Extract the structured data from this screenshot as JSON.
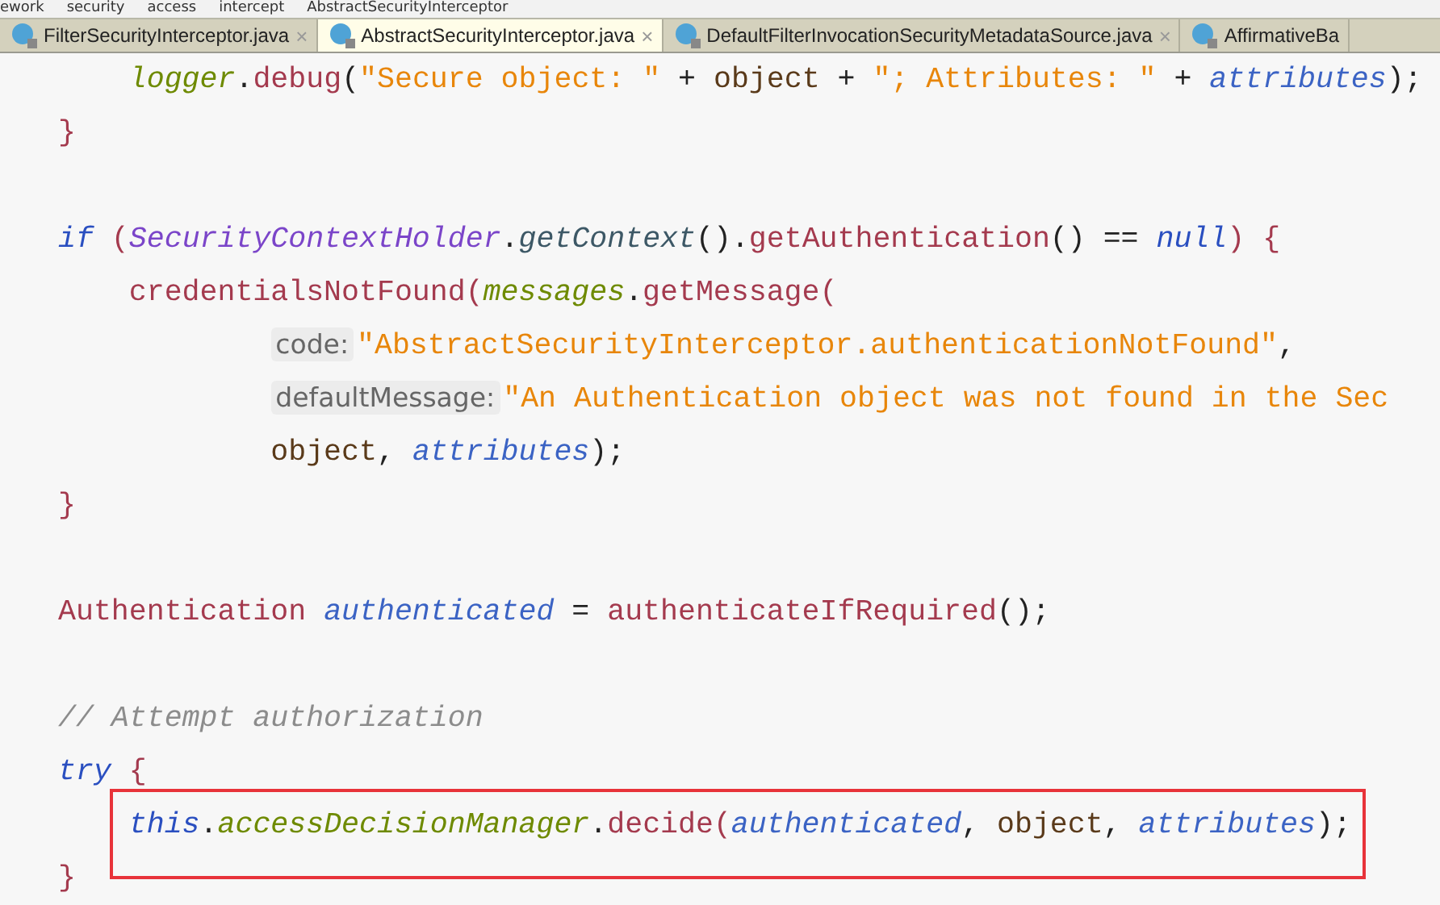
{
  "breadcrumb": [
    "ework",
    "security",
    "access",
    "intercept",
    "AbstractSecurityInterceptor"
  ],
  "tabs": [
    {
      "label": "FilterSecurityInterceptor.java",
      "selected": false,
      "close": "×"
    },
    {
      "label": "AbstractSecurityInterceptor.java",
      "selected": true,
      "close": "×"
    },
    {
      "label": "DefaultFilterInvocationSecurityMetadataSource.java",
      "selected": false,
      "close": "×"
    },
    {
      "label": "AffirmativeBa",
      "selected": false
    }
  ],
  "lines": [
    {
      "kind": "code",
      "highlighted": false,
      "tokens": [
        {
          "text": "    logger",
          "kind": "field"
        },
        {
          "text": ".",
          "kind": "plain"
        },
        {
          "text": "debug",
          "kind": "method"
        },
        {
          "text": "(",
          "kind": "plain"
        },
        {
          "text": "\"Secure object: \"",
          "kind": "string"
        },
        {
          "text": " + ",
          "kind": "plain"
        },
        {
          "text": "object",
          "kind": "param"
        },
        {
          "text": " + ",
          "kind": "plain"
        },
        {
          "text": "\"; Attributes: \"",
          "kind": "string"
        },
        {
          "text": " + ",
          "kind": "plain"
        },
        {
          "text": "attributes",
          "kind": "local"
        },
        {
          "text": ");",
          "kind": "plain"
        }
      ]
    },
    {
      "kind": "code",
      "highlighted": false,
      "tokens": [
        {
          "text": "}",
          "kind": "method"
        }
      ]
    },
    {
      "kind": "blank"
    },
    {
      "kind": "code",
      "highlighted": false,
      "tokens": [
        {
          "text": "if",
          "kind": "keyword"
        },
        {
          "text": " (",
          "kind": "method"
        },
        {
          "text": "SecurityContextHolder",
          "kind": "class"
        },
        {
          "text": ".",
          "kind": "plain"
        },
        {
          "text": "getContext",
          "kind": "static"
        },
        {
          "text": "().",
          "kind": "plain"
        },
        {
          "text": "getAuthentication",
          "kind": "method"
        },
        {
          "text": "() == ",
          "kind": "plain"
        },
        {
          "text": "null",
          "kind": "keyword"
        },
        {
          "text": ") {",
          "kind": "method"
        }
      ]
    },
    {
      "kind": "code",
      "highlighted": false,
      "tokens": [
        {
          "text": "    credentialsNotFound(",
          "kind": "method"
        },
        {
          "text": "messages",
          "kind": "field"
        },
        {
          "text": ".",
          "kind": "plain"
        },
        {
          "text": "getMessage(",
          "kind": "method"
        }
      ]
    },
    {
      "kind": "code",
      "highlighted": false,
      "tokens": [
        {
          "text": "            code:",
          "kind": "hint"
        },
        {
          "text": "\"AbstractSecurityInterceptor.authenticationNotFound\"",
          "kind": "string"
        },
        {
          "text": ",",
          "kind": "plain"
        }
      ]
    },
    {
      "kind": "code",
      "highlighted": false,
      "tokens": [
        {
          "text": "            defaultMessage:",
          "kind": "hint"
        },
        {
          "text": "\"An Authentication object was not found in the Sec",
          "kind": "string"
        }
      ]
    },
    {
      "kind": "code",
      "highlighted": false,
      "tokens": [
        {
          "text": "            object",
          "kind": "param"
        },
        {
          "text": ", ",
          "kind": "plain"
        },
        {
          "text": "attributes",
          "kind": "local"
        },
        {
          "text": ");",
          "kind": "plain"
        }
      ]
    },
    {
      "kind": "code",
      "highlighted": false,
      "tokens": [
        {
          "text": "}",
          "kind": "method"
        }
      ]
    },
    {
      "kind": "blank"
    },
    {
      "kind": "code",
      "highlighted": false,
      "tokens": [
        {
          "text": "Authentication ",
          "kind": "method"
        },
        {
          "text": "authenticated",
          "kind": "local"
        },
        {
          "text": " = ",
          "kind": "plain"
        },
        {
          "text": "authenticateIfRequired",
          "kind": "method"
        },
        {
          "text": "();",
          "kind": "plain"
        }
      ]
    },
    {
      "kind": "blank"
    },
    {
      "kind": "code",
      "highlighted": false,
      "tokens": [
        {
          "text": "// Attempt authorization",
          "kind": "comment"
        }
      ]
    },
    {
      "kind": "code",
      "highlighted": false,
      "tokens": [
        {
          "text": "try",
          "kind": "keyword"
        },
        {
          "text": " {",
          "kind": "method"
        }
      ]
    },
    {
      "kind": "code",
      "highlighted": true,
      "tokens": [
        {
          "text": "    this",
          "kind": "keyword"
        },
        {
          "text": ".",
          "kind": "plain"
        },
        {
          "text": "accessDecisionManager",
          "kind": "field"
        },
        {
          "text": ".",
          "kind": "plain"
        },
        {
          "text": "decide(",
          "kind": "method"
        },
        {
          "text": "authenticated",
          "kind": "local"
        },
        {
          "text": ", ",
          "kind": "plain"
        },
        {
          "text": "object",
          "kind": "param"
        },
        {
          "text": ", ",
          "kind": "plain"
        },
        {
          "text": "attributes",
          "kind": "local"
        },
        {
          "text": ");",
          "kind": "plain"
        }
      ]
    },
    {
      "kind": "code",
      "highlighted": false,
      "tokens": [
        {
          "text": "}",
          "kind": "method"
        }
      ]
    }
  ]
}
